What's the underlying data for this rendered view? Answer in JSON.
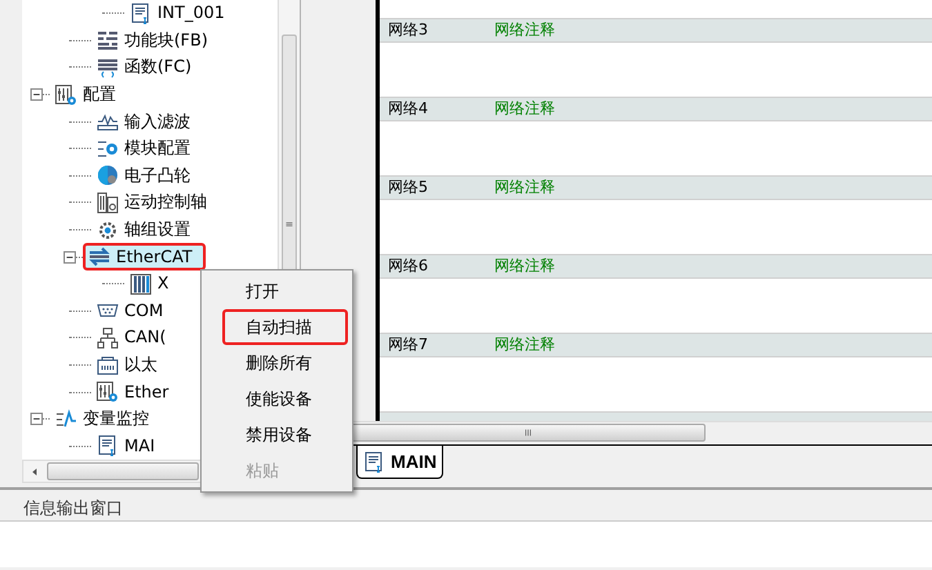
{
  "tree": {
    "items": [
      {
        "children": [
          {
            "children": [
              {
                "label": "INT_001",
                "kind": "doc",
                "selected": false,
                "marked": false
              }
            ]
          },
          {
            "label": "功能块(FB)",
            "kind": "fb",
            "selected": false,
            "marked": false
          },
          {
            "label": "函数(FC)",
            "kind": "fc",
            "selected": false,
            "marked": false
          }
        ]
      },
      {
        "label": "配置",
        "kind": "config",
        "expanded": true,
        "selected": false,
        "marked": false,
        "children": [
          {
            "label": "输入滤波",
            "kind": "filter",
            "selected": false,
            "marked": false
          },
          {
            "label": "模块配置",
            "kind": "module",
            "selected": false,
            "marked": false
          },
          {
            "label": "电子凸轮",
            "kind": "cam",
            "selected": false,
            "marked": false
          },
          {
            "label": "运动控制轴",
            "kind": "axis",
            "selected": false,
            "marked": false
          },
          {
            "label": "轴组设置",
            "kind": "gear",
            "selected": false,
            "marked": false
          },
          {
            "label": "EtherCAT",
            "kind": "ethercat",
            "expanded": true,
            "selected": true,
            "marked": true,
            "children": [
              {
                "label": "X",
                "kind": "device",
                "selected": false,
                "marked": false
              }
            ]
          },
          {
            "label": "COM",
            "kind": "serial",
            "selected": false,
            "marked": false
          },
          {
            "label": "CAN(",
            "kind": "network",
            "selected": false,
            "marked": false
          },
          {
            "label": "以太",
            "kind": "ethernet",
            "selected": false,
            "marked": false
          },
          {
            "label": "Ether",
            "kind": "config",
            "selected": false,
            "marked": false
          }
        ]
      },
      {
        "label": "变量监控",
        "kind": "monitor",
        "expanded": true,
        "selected": false,
        "marked": false,
        "children": [
          {
            "label": "MAI",
            "kind": "doc",
            "selected": false,
            "marked": false
          }
        ]
      }
    ]
  },
  "editor": {
    "networks": [
      {
        "label": "网络3",
        "comment": "网络注释"
      },
      {
        "label": "网络4",
        "comment": "网络注释"
      },
      {
        "label": "网络5",
        "comment": "网络注释"
      },
      {
        "label": "网络6",
        "comment": "网络注释"
      },
      {
        "label": "网络7",
        "comment": "网络注释"
      }
    ]
  },
  "tabs": [
    {
      "label": "MAIN",
      "selected": true
    }
  ],
  "context_menu": {
    "items": [
      {
        "label": "打开",
        "disabled": false,
        "marked": false
      },
      {
        "label": "自动扫描",
        "disabled": false,
        "marked": true
      },
      {
        "label": "删除所有",
        "disabled": false,
        "marked": false
      },
      {
        "label": "使能设备",
        "disabled": false,
        "marked": false
      },
      {
        "label": "禁用设备",
        "disabled": false,
        "marked": false
      },
      {
        "label": "粘贴",
        "disabled": true,
        "marked": false
      }
    ]
  },
  "output_panel": {
    "title": "信息输出窗口"
  }
}
